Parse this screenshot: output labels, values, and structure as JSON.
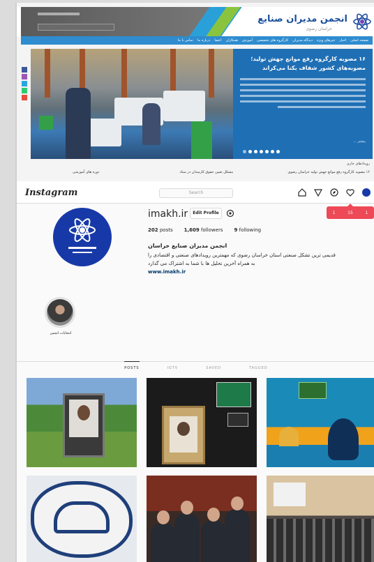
{
  "site": {
    "title": "انجمن مدیران صنایع",
    "subtitle": "خراسان رضوی",
    "nav": [
      "صفحه اصلی",
      "اخبار",
      "خبرهای ویژه",
      "دیدگاه مدیران",
      "کارگروه های تخصصی",
      "آموزش",
      "همکاران",
      "اعضا",
      "درباره ما",
      "تماس با ما"
    ],
    "hero_headline": "۱۶ مصوبه کارگروه رفع موانع جهش تولید؛ مصوبه‌های کشور شفاف بکنا می‌کراند",
    "hero_more": "بیشتر ...",
    "news_label": "رویدادهای جاری",
    "news_items": [
      "۱۶ مصوبه کارگروه رفع موانع جهش تولید خراسان رضوی",
      "مشکل تعیین حقوق کارمندان در ستاد",
      "دوره های آموزشی"
    ],
    "accent": "#1f6fb5"
  },
  "instagram": {
    "brand": "Instagram",
    "search_placeholder": "Search",
    "notifications": {
      "follows": "1",
      "likes": "15",
      "comments": "1"
    },
    "username": "imakh.ir",
    "edit_profile": "Edit Profile",
    "stats": {
      "posts": "202",
      "posts_label": "posts",
      "followers": "1,609",
      "followers_label": "followers",
      "following": "9",
      "following_label": "following"
    },
    "bio_name": "انجمن مدیران صنایع خراسان",
    "bio_line1": "قدیمی ترین تشکل صنعتی استان خراسان رضوی که مهمترین رویدادهای صنعتی و اقتصادی را",
    "bio_line2": "به همراه آخرین تحلیل ها با شما به اشتراک می گذارد",
    "link": "www.imakh.ir",
    "highlight_label": "انتخابات انجمن",
    "tabs": [
      "POSTS",
      "IGTV",
      "SAVED",
      "TAGGED"
    ],
    "brand_color": "#ed4956"
  }
}
